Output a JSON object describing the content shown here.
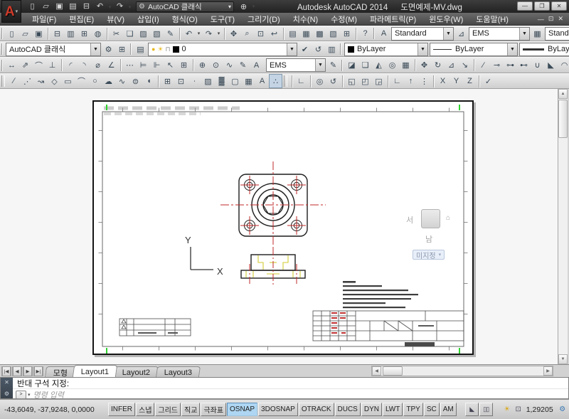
{
  "titlebar": {
    "app_title": "Autodesk AutoCAD 2014",
    "doc_title": "도면예제-MV.dwg",
    "logo_letter": "A",
    "logo_caret": "▾",
    "qat_icons": [
      {
        "name": "qnew-icon",
        "glyph": "▯"
      },
      {
        "name": "open-icon",
        "glyph": "▱"
      },
      {
        "name": "save-icon",
        "glyph": "▣"
      },
      {
        "name": "saveas-icon",
        "glyph": "▤"
      },
      {
        "name": "plot-icon",
        "glyph": "⊟"
      },
      {
        "name": "undo-icon",
        "glyph": "↶"
      },
      {
        "name": "undo-caret-icon",
        "glyph": "▾",
        "cls": "caret"
      },
      {
        "name": "redo-icon",
        "glyph": "↷"
      },
      {
        "name": "redo-caret-icon",
        "glyph": "▾",
        "cls": "caret"
      }
    ],
    "workspace_dropdown": {
      "gear": "⚙",
      "value": "AutoCAD 클래식",
      "caret": "▾"
    },
    "batch_plot_icon": "⊕",
    "batch_plot_caret": "▾",
    "win_buttons": [
      {
        "name": "minimize-button",
        "glyph": "—"
      },
      {
        "name": "restore-button",
        "glyph": "❐"
      },
      {
        "name": "close-button",
        "glyph": "✕"
      }
    ]
  },
  "menubar": {
    "items": [
      "파일(F)",
      "편집(E)",
      "뷰(V)",
      "삽입(I)",
      "형식(O)",
      "도구(T)",
      "그리기(D)",
      "치수(N)",
      "수정(M)",
      "파라메트릭(P)",
      "윈도우(W)",
      "도움말(H)"
    ],
    "doc_buttons": [
      {
        "name": "doc-minimize-icon",
        "glyph": "—"
      },
      {
        "name": "doc-restore-icon",
        "glyph": "⊡"
      },
      {
        "name": "doc-close-icon",
        "glyph": "✕"
      }
    ]
  },
  "toolbars": {
    "standard": {
      "icons": [
        {
          "name": "qnew-icon",
          "glyph": "▯"
        },
        {
          "name": "open-icon",
          "glyph": "▱"
        },
        {
          "name": "save-icon",
          "glyph": "▣"
        },
        {
          "name": "plot-icon",
          "glyph": "⊟",
          "sep": true
        },
        {
          "name": "plot-preview-icon",
          "glyph": "▥"
        },
        {
          "name": "publish-icon",
          "glyph": "⊞"
        },
        {
          "name": "export-icon",
          "glyph": "◍"
        },
        {
          "name": "cut-icon",
          "glyph": "✂",
          "sep": true
        },
        {
          "name": "copy-icon",
          "glyph": "❏"
        },
        {
          "name": "paste-icon",
          "glyph": "▨"
        },
        {
          "name": "paste-special-icon",
          "glyph": "▧"
        },
        {
          "name": "match-properties-icon",
          "glyph": "✎"
        },
        {
          "name": "undo-icon",
          "glyph": "↶",
          "sep": true
        },
        {
          "name": "undo-caret-icon",
          "glyph": "▾",
          "cls": "caret"
        },
        {
          "name": "redo-icon",
          "glyph": "↷"
        },
        {
          "name": "redo-caret-icon",
          "glyph": "▾",
          "cls": "caret"
        },
        {
          "name": "pan-icon",
          "glyph": "✥",
          "sep": true
        },
        {
          "name": "zoom-realtime-icon",
          "glyph": "⌕"
        },
        {
          "name": "zoom-window-icon",
          "glyph": "⊡"
        },
        {
          "name": "zoom-previous-icon",
          "glyph": "↩"
        },
        {
          "name": "properties-icon",
          "glyph": "▤",
          "sep": true
        },
        {
          "name": "designcenter-icon",
          "glyph": "▦"
        },
        {
          "name": "tool-palettes-icon",
          "glyph": "▩"
        },
        {
          "name": "sheet-set-manager-icon",
          "glyph": "▧"
        },
        {
          "name": "quickcalc-icon",
          "glyph": "⊞"
        },
        {
          "name": "help-icon",
          "glyph": "?",
          "sep": true
        }
      ]
    },
    "styles": {
      "text_style_icon": "A",
      "text_style": "Standard",
      "dim_style_icon": "⊿",
      "dim_style": "EMS",
      "table_style_icon": "▦",
      "table_style": "Standard"
    },
    "workspaces": {
      "value": "AutoCAD 클래식",
      "icons": [
        {
          "name": "workspace-settings-icon",
          "glyph": "⚙"
        },
        {
          "name": "save-workspace-icon",
          "glyph": "⊞"
        }
      ]
    },
    "layers": {
      "manager_icon": "▤",
      "bulb_icon": "●",
      "sun_icon": "☀",
      "lock_icon": "⊓",
      "swatch": "■",
      "layer_name": "0",
      "icons": [
        {
          "name": "make-object-layer-current-icon",
          "glyph": "✔"
        },
        {
          "name": "layer-previous-icon",
          "glyph": "↺"
        },
        {
          "name": "layer-states-icon",
          "glyph": "▥"
        }
      ]
    },
    "properties": {
      "color_value": "ByLayer",
      "linetype_value": "ByLayer",
      "lineweight_value": "ByLayer"
    },
    "dimension": {
      "style_value": "EMS",
      "apply_icon": "✎",
      "icons": [
        {
          "name": "dim-linear-icon",
          "glyph": "↔"
        },
        {
          "name": "dim-aligned-icon",
          "glyph": "⇗"
        },
        {
          "name": "dim-arc-length-icon",
          "glyph": "⌒"
        },
        {
          "name": "dim-ordinate-icon",
          "glyph": "⊥"
        },
        {
          "name": "dim-radius-icon",
          "glyph": "◜",
          "sep": true
        },
        {
          "name": "dim-jogged-icon",
          "glyph": "◝"
        },
        {
          "name": "dim-diameter-icon",
          "glyph": "⌀"
        },
        {
          "name": "dim-angular-icon",
          "glyph": "∠"
        },
        {
          "name": "quick-dimension-icon",
          "glyph": "⋯",
          "sep": true
        },
        {
          "name": "dim-baseline-icon",
          "glyph": "⊨"
        },
        {
          "name": "dim-continue-icon",
          "glyph": "⊩"
        },
        {
          "name": "quick-leader-icon",
          "glyph": "↖"
        },
        {
          "name": "tolerance-icon",
          "glyph": "⊞"
        },
        {
          "name": "center-mark-icon",
          "glyph": "⊕",
          "sep": true
        },
        {
          "name": "dim-inspection-icon",
          "glyph": "⊙"
        },
        {
          "name": "dim-jog-line-icon",
          "glyph": "∿"
        },
        {
          "name": "dim-edit-icon",
          "glyph": "✎"
        },
        {
          "name": "dim-text-edit-icon",
          "glyph": "A"
        }
      ]
    },
    "modify": {
      "icons": [
        {
          "name": "erase-icon",
          "glyph": "◪"
        },
        {
          "name": "copy-icon",
          "glyph": "❏"
        },
        {
          "name": "mirror-icon",
          "glyph": "◭"
        },
        {
          "name": "offset-icon",
          "glyph": "◎"
        },
        {
          "name": "array-icon",
          "glyph": "▦"
        },
        {
          "name": "move-icon",
          "glyph": "✥",
          "sep": true
        },
        {
          "name": "rotate-icon",
          "glyph": "↻"
        },
        {
          "name": "scale-icon",
          "glyph": "⊿"
        },
        {
          "name": "stretch-icon",
          "glyph": "↘"
        },
        {
          "name": "trim-icon",
          "glyph": "∕",
          "sep": true
        },
        {
          "name": "extend-icon",
          "glyph": "⊸"
        },
        {
          "name": "break-at-point-icon",
          "glyph": "⊶"
        },
        {
          "name": "break-icon",
          "glyph": "⊷"
        },
        {
          "name": "join-icon",
          "glyph": "∪"
        },
        {
          "name": "chamfer-icon",
          "glyph": "◣"
        },
        {
          "name": "fillet-icon",
          "glyph": "◠"
        }
      ]
    },
    "draw": {
      "icons": [
        {
          "name": "line-icon",
          "glyph": "∕"
        },
        {
          "name": "construction-line-icon",
          "glyph": "⋰"
        },
        {
          "name": "polyline-icon",
          "glyph": "↝"
        },
        {
          "name": "polygon-icon",
          "glyph": "◇"
        },
        {
          "name": "rectangle-icon",
          "glyph": "▭"
        },
        {
          "name": "arc-icon",
          "glyph": "⌒"
        },
        {
          "name": "circle-icon",
          "glyph": "○"
        },
        {
          "name": "revcloud-icon",
          "glyph": "☁"
        },
        {
          "name": "spline-icon",
          "glyph": "∿"
        },
        {
          "name": "ellipse-icon",
          "glyph": "⊜"
        },
        {
          "name": "ellipse-arc-icon",
          "glyph": "◖"
        },
        {
          "name": "insert-block-icon",
          "glyph": "⊞",
          "sep": true
        },
        {
          "name": "make-block-icon",
          "glyph": "⊡"
        },
        {
          "name": "point-icon",
          "glyph": "∙"
        },
        {
          "name": "hatch-icon",
          "glyph": "▨"
        },
        {
          "name": "gradient-icon",
          "glyph": "▓"
        },
        {
          "name": "region-icon",
          "glyph": "▢"
        },
        {
          "name": "table-icon",
          "glyph": "▦"
        },
        {
          "name": "mtext-icon",
          "glyph": "A"
        },
        {
          "name": "point-style-icon",
          "glyph": "∴",
          "pressed": true
        }
      ]
    },
    "ucs": {
      "icons": [
        {
          "name": "ucs-icon",
          "glyph": "∟",
          "sep": true
        },
        {
          "name": "ucs-world-icon",
          "glyph": "◎",
          "sep": true
        },
        {
          "name": "ucs-previous-icon",
          "glyph": "↺"
        },
        {
          "name": "ucs-face-icon",
          "glyph": "◱",
          "sep": true
        },
        {
          "name": "ucs-object-icon",
          "glyph": "◰"
        },
        {
          "name": "ucs-view-icon",
          "glyph": "◲"
        },
        {
          "name": "ucs-origin-icon",
          "glyph": "∟",
          "sep": true
        },
        {
          "name": "ucs-zaxis-icon",
          "glyph": "↑"
        },
        {
          "name": "ucs-3point-icon",
          "glyph": "⋮"
        },
        {
          "name": "ucs-x-icon",
          "glyph": "X",
          "sep": true
        },
        {
          "name": "ucs-y-icon",
          "glyph": "Y"
        },
        {
          "name": "ucs-z-icon",
          "glyph": "Z"
        },
        {
          "name": "ucs-apply-icon",
          "glyph": "✓",
          "sep": true
        }
      ]
    }
  },
  "drawing": {
    "ucs_label_x": "X",
    "ucs_label_y": "Y"
  },
  "viewcube": {
    "west": "서",
    "south": "남",
    "home_icon": "⌂",
    "unnamed_view_label": "미지정",
    "caret": "▾"
  },
  "layout_tabs": {
    "nav": [
      {
        "name": "tab-first-icon",
        "glyph": "|◀"
      },
      {
        "name": "tab-prev-icon",
        "glyph": "◀"
      },
      {
        "name": "tab-next-icon",
        "glyph": "▶"
      },
      {
        "name": "tab-last-icon",
        "glyph": "▶|"
      }
    ],
    "tabs": [
      {
        "label": "모형"
      },
      {
        "label": "Layout1",
        "active": true
      },
      {
        "label": "Layout2"
      },
      {
        "label": "Layout3"
      }
    ]
  },
  "command": {
    "history_line": "반대 구석 지정:",
    "prompt_icon": ">",
    "prompt_caret": "▾",
    "placeholder": "명령 입력",
    "close_icon": "✕",
    "wrench_icon": "⚙"
  },
  "statusbar": {
    "coords": "-43,6049, -37,9248, 0,0000",
    "toggles": [
      {
        "label": "INFER"
      },
      {
        "label": "스냅"
      },
      {
        "label": "그리드"
      },
      {
        "label": "직교"
      },
      {
        "label": "극좌표"
      },
      {
        "label": "OSNAP",
        "active": true
      },
      {
        "label": "3DOSNAP"
      },
      {
        "label": "OTRACK"
      },
      {
        "label": "DUCS"
      },
      {
        "label": "DYN"
      },
      {
        "label": "LWT"
      },
      {
        "label": "TPY"
      },
      {
        "label": "SC"
      },
      {
        "label": "AM"
      }
    ],
    "mode_icons": [
      {
        "name": "paper-space-icon",
        "glyph": "◣"
      },
      {
        "name": "quick-view-layouts-icon",
        "glyph": "▯▯"
      }
    ],
    "annotation": {
      "visibility_icon": "☀",
      "scale_icon": "⊡",
      "scale": "1,29205"
    },
    "tray_icons": [
      {
        "name": "workspace-switching-icon",
        "glyph": "⚙",
        "cls": "blue"
      },
      {
        "name": "toolbar-lock-icon",
        "glyph": "⚠",
        "cls": "amber"
      },
      {
        "name": "tray-bulb-icon",
        "glyph": "●",
        "cls": "amber"
      },
      {
        "name": "tray-plot-icon",
        "glyph": "▭"
      }
    ],
    "menu_caret_icon": "▾",
    "clean_screen_icon": "▢"
  },
  "colors": {
    "toggle_active": "#aed6f2",
    "centerline_red": "#c02a2a",
    "hidden_line_yellow": "#d9d455",
    "grip_green": "#2fd32f",
    "titlebar": "#2b2b2b"
  }
}
